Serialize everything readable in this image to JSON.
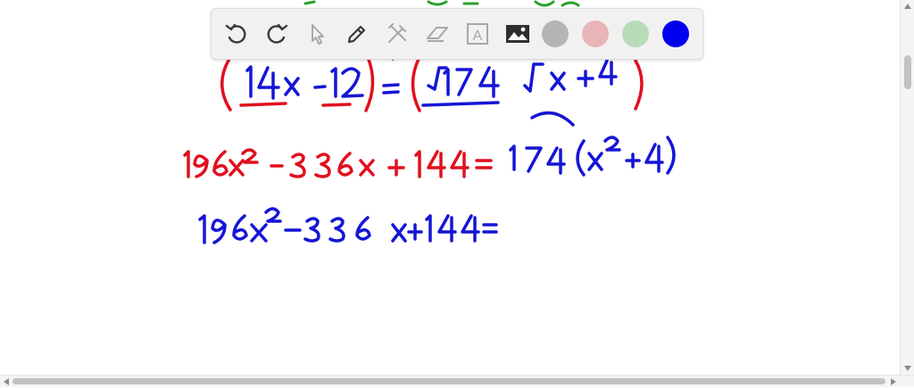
{
  "toolbar": {
    "tools": [
      {
        "name": "undo-icon",
        "enabled": true
      },
      {
        "name": "redo-icon",
        "enabled": true
      },
      {
        "name": "select-arrow-icon",
        "enabled": false
      },
      {
        "name": "pen-icon",
        "enabled": true
      },
      {
        "name": "tools-icon",
        "enabled": false
      },
      {
        "name": "eraser-icon",
        "enabled": false
      },
      {
        "name": "text-icon",
        "enabled": false
      },
      {
        "name": "image-icon",
        "enabled": true
      }
    ],
    "colors": [
      "#b5b5b5",
      "#e8b4b8",
      "#b8dcb8",
      "#0000ee"
    ],
    "selected_color": "#0000ee",
    "text_tool_glyph": "A"
  },
  "ink_colors": {
    "red": "#e0101e",
    "blue": "#1515d6",
    "green": "#2aa02a"
  }
}
